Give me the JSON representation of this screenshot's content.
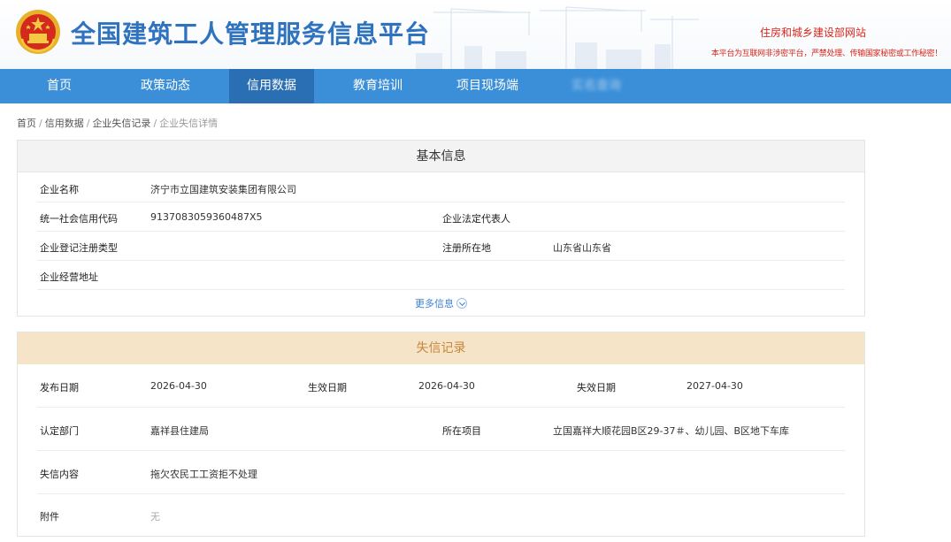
{
  "header": {
    "site_title": "全国建筑工人管理服务信息平台",
    "ministry": "住房和城乡建设部网站",
    "notice": "本平台为互联网非涉密平台，严禁处理、传输国家秘密或工作秘密！"
  },
  "nav": {
    "items": [
      {
        "label": "首页"
      },
      {
        "label": "政策动态"
      },
      {
        "label": "信用数据",
        "active": true
      },
      {
        "label": "教育培训"
      },
      {
        "label": "项目现场端"
      },
      {
        "label": "实名查询"
      }
    ]
  },
  "breadcrumb": [
    "首页",
    "信用数据",
    "企业失信记录",
    "企业失信详情"
  ],
  "basic_info": {
    "title": "基本信息",
    "company_name_label": "企业名称",
    "company_name": "济宁市立国建筑安装集团有限公司",
    "credit_code_label": "统一社会信用代码",
    "credit_code": "9137083059360487X5",
    "legal_rep_label": "企业法定代表人",
    "legal_rep": "",
    "reg_type_label": "企业登记注册类型",
    "reg_type": "",
    "reg_location_label": "注册所在地",
    "reg_location": "山东省山东省",
    "address_label": "企业经营地址",
    "address": "",
    "more_label": "更多信息"
  },
  "credit_record": {
    "title": "失信记录",
    "publish_date_label": "发布日期",
    "publish_date": "2026-04-30",
    "effective_date_label": "生效日期",
    "effective_date": "2026-04-30",
    "expiry_date_label": "失效日期",
    "expiry_date": "2027-04-30",
    "department_label": "认定部门",
    "department": "嘉祥县住建局",
    "project_label": "所在项目",
    "project": "立国嘉祥大顺花园B区29-37＃、幼儿园、B区地下车库",
    "content_label": "失信内容",
    "content": "拖欠农民工工资拒不处理",
    "attachment_label": "附件",
    "attachment": "无"
  },
  "colors": {
    "nav_bg": "#3b8fd8",
    "nav_active": "#2a6fb3",
    "title_blue": "#2f72be",
    "ministry_red": "#d8261c",
    "credit_head_bg": "#f6e4c8",
    "credit_head_text": "#c8873a"
  },
  "icons": {
    "emblem": "national-emblem-icon",
    "more": "chevron-down-icon"
  }
}
